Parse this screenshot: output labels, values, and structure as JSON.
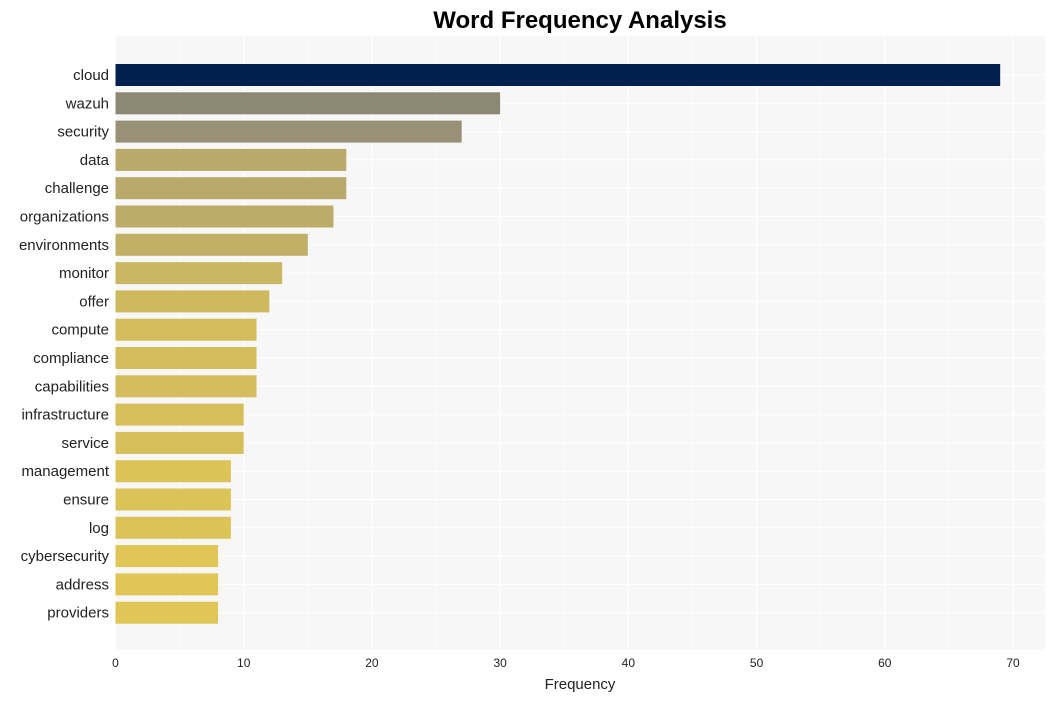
{
  "chart_data": {
    "type": "bar",
    "orientation": "horizontal",
    "title": "Word Frequency Analysis",
    "xlabel": "Frequency",
    "ylabel": "",
    "xlim": [
      0,
      72
    ],
    "xticks": [
      0,
      10,
      20,
      30,
      40,
      50,
      60,
      70
    ],
    "grid": true,
    "categories": [
      "cloud",
      "wazuh",
      "security",
      "data",
      "challenge",
      "organizations",
      "environments",
      "monitor",
      "offer",
      "compute",
      "compliance",
      "capabilities",
      "infrastructure",
      "service",
      "management",
      "ensure",
      "log",
      "cybersecurity",
      "address",
      "providers"
    ],
    "values": [
      69,
      30,
      27,
      18,
      18,
      17,
      15,
      13,
      12,
      11,
      11,
      11,
      10,
      10,
      9,
      9,
      9,
      8,
      8,
      8
    ],
    "colors": [
      "#00204e",
      "#8c8873",
      "#999177",
      "#b9aa6b",
      "#b9aa6b",
      "#bcac6a",
      "#c2b066",
      "#cbb762",
      "#ceb960",
      "#d3bd5c",
      "#d3bd5c",
      "#d3bd5c",
      "#d6bf5a",
      "#d6bf5a",
      "#dbc358",
      "#dbc358",
      "#dbc358",
      "#e0c656",
      "#e0c656",
      "#e0c656"
    ]
  }
}
